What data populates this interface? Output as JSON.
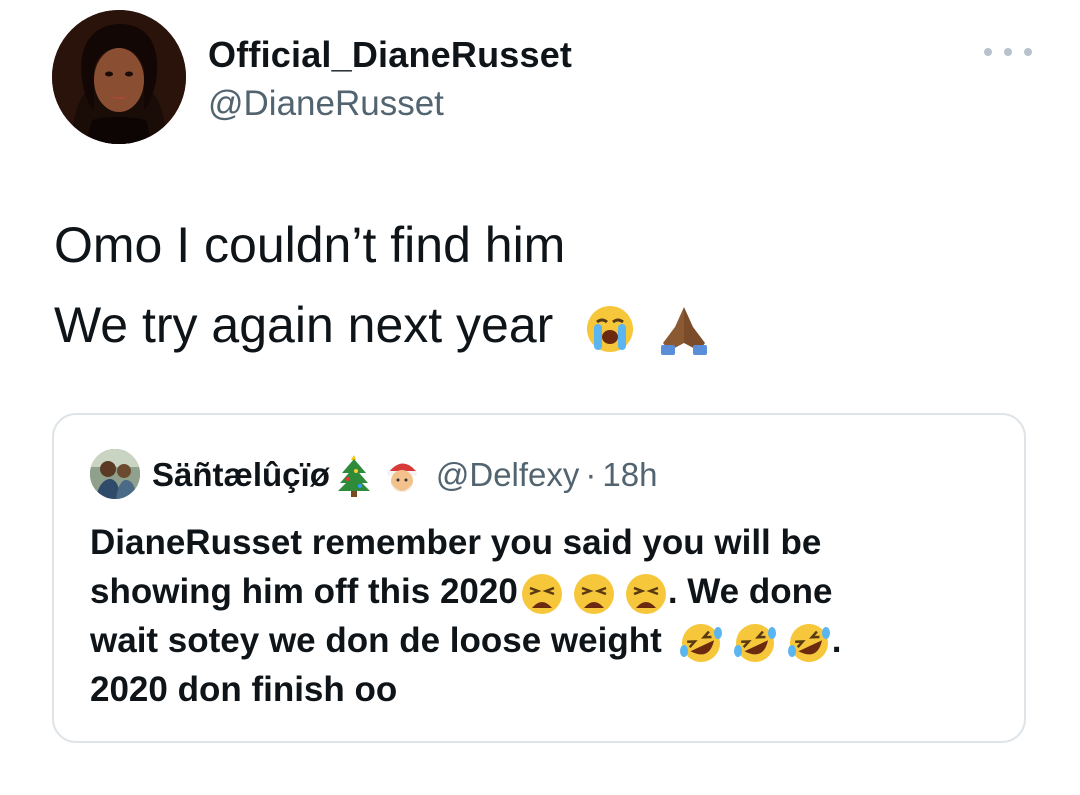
{
  "author": {
    "display_name": "Official_DianeRusset",
    "handle": "@DianeRusset",
    "avatar_icon": "profile-photo-icon"
  },
  "more_icon": "more-options-icon",
  "tweet": {
    "line1": "Omo I couldn’t find him",
    "line2": "We try again next year",
    "emojis": [
      "loudly-crying-face",
      "folded-hands"
    ]
  },
  "quoted": {
    "display_name": "Säñtælûçïø",
    "name_emojis": [
      "christmas-tree",
      "santa-face"
    ],
    "handle": "@Delfexy",
    "separator": "·",
    "time": "18h",
    "line1": "DianeRusset remember you said you will be",
    "line2_text": "showing him off this 2020",
    "line2_tail": ". We done",
    "line3_text": "wait sotey we don de loose weight",
    "line3_tail": ".",
    "line4": "2020 don finish oo",
    "line2_emojis": [
      "weary-face",
      "weary-face",
      "weary-face"
    ],
    "line3_emojis": [
      "rolling-laughing-face",
      "rolling-laughing-face",
      "rolling-laughing-face"
    ]
  },
  "colors": {
    "text": "#0f1419",
    "secondary": "#536471",
    "border": "#dfe4e8",
    "emoji_yellow": "#f7c73b"
  }
}
